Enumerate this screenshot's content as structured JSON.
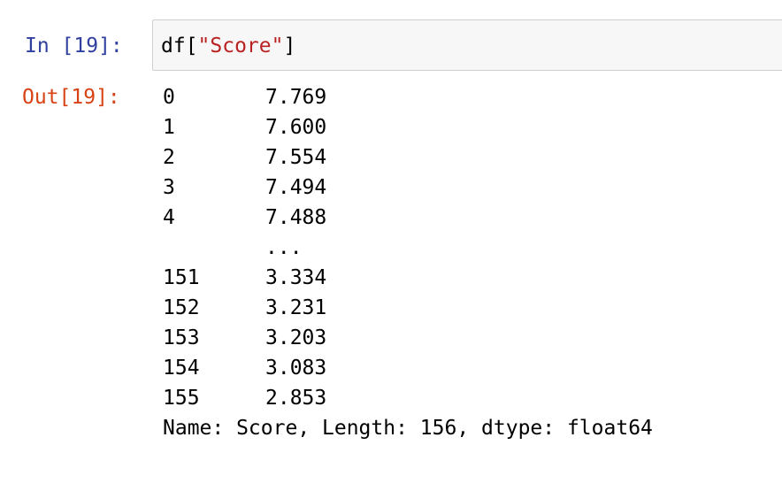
{
  "cell": {
    "in_prompt": "In [19]:",
    "out_prompt": "Out[19]:",
    "code": {
      "prefix": "df[",
      "string": "\"Score\"",
      "suffix": "]"
    }
  },
  "output": {
    "rows": [
      {
        "index": "0",
        "value": "7.769"
      },
      {
        "index": "1",
        "value": "7.600"
      },
      {
        "index": "2",
        "value": "7.554"
      },
      {
        "index": "3",
        "value": "7.494"
      },
      {
        "index": "4",
        "value": "7.488"
      },
      {
        "index": "",
        "value": "..."
      },
      {
        "index": "151",
        "value": "3.334"
      },
      {
        "index": "152",
        "value": "3.231"
      },
      {
        "index": "153",
        "value": "3.203"
      },
      {
        "index": "154",
        "value": "3.083"
      },
      {
        "index": "155",
        "value": "2.853"
      }
    ],
    "footer": "Name: Score, Length: 156, dtype: float64"
  },
  "colors": {
    "in_prompt": "#303f9f",
    "out_prompt": "#d84315",
    "string_literal": "#ba2121",
    "input_background": "#f7f7f7",
    "input_border": "#cfcfcf"
  }
}
